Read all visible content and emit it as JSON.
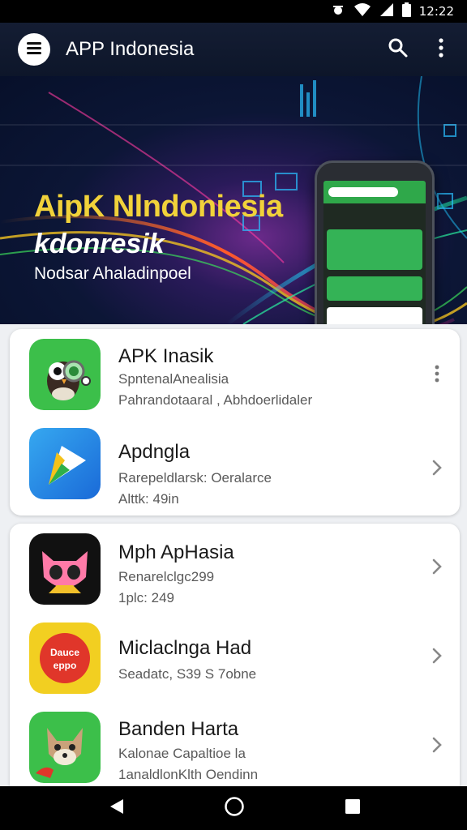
{
  "status_bar": {
    "time": "12:22",
    "icons": [
      "debug-icon",
      "wifi-icon",
      "signal-icon",
      "battery-icon"
    ]
  },
  "app_bar": {
    "title": "APP Indonesia",
    "menu_icon": "menu-icon",
    "search_icon": "search-icon",
    "more_icon": "more-vert-icon"
  },
  "banner": {
    "headline": "AipK Nlndoniesia",
    "subheadline": "kdonresik",
    "tagline": "Nodsar Ahaladinpoel",
    "page_count": 4,
    "active_page": 2,
    "accent_color": "#f1d23a"
  },
  "card1": {
    "items": [
      {
        "name": "APK Inasik",
        "line1": "SpntenalAnealisia",
        "line2": "Pahrandotaaral , Abhdoerlidaler",
        "action_icon": "more-vert-icon",
        "icon": "owl-app-icon",
        "icon_bg": "#3cbf4a"
      },
      {
        "name": "Apdngla",
        "line1": "Rarepeldlarsk: Oeralarce",
        "line2": "Alttk: 49in",
        "action_icon": "chevron-right-icon",
        "icon": "play-arrow-app-icon",
        "icon_bg": "#2a86e6"
      }
    ]
  },
  "card2": {
    "items": [
      {
        "name": "Mph ApHasia",
        "line1": "Renarelclgc299",
        "line2": "1plc: 249",
        "action_icon": "chevron-right-icon",
        "icon": "pink-cat-app-icon",
        "icon_bg": "#111"
      },
      {
        "name": "Miclaclnga Had",
        "line1": "Seadatc, S39 S 7obne",
        "line2": "",
        "action_icon": "chevron-right-icon",
        "icon": "badge-app-icon",
        "icon_bg": "#f2cf21",
        "icon_text_top": "Dauce",
        "icon_text_bottom": "eppo"
      },
      {
        "name": "Banden Harta",
        "line1": "Kalonae Capaltioe la",
        "line2": "1analdlonKlth Oendinn",
        "action_icon": "chevron-right-icon",
        "icon": "fox-app-icon",
        "icon_bg": "#3cbf4a"
      }
    ]
  },
  "nav_bar": {
    "back_icon": "back-triangle-icon",
    "home_icon": "home-circle-icon",
    "recents_icon": "recents-square-icon"
  }
}
